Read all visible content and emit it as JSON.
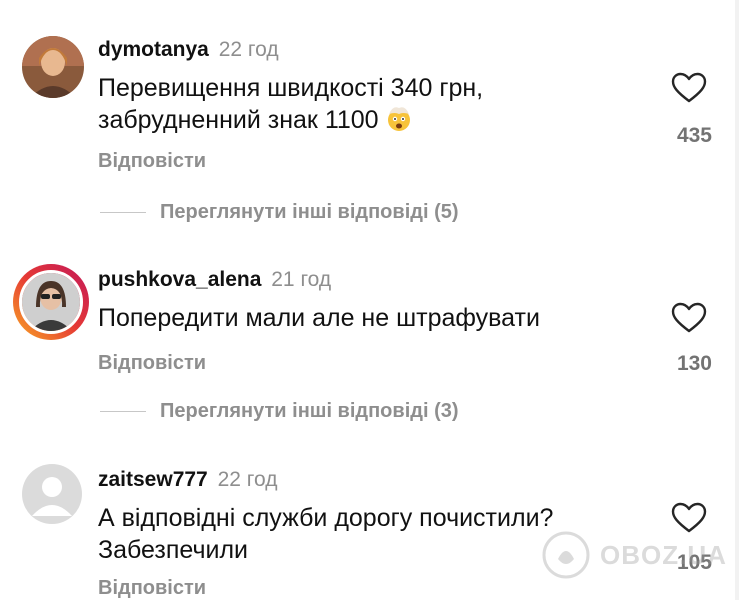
{
  "comments": [
    {
      "username": "dymotanya",
      "time": "22 год",
      "text_line1": "Перевищення швидкості 340 грн,",
      "text_line2": "забрудненний знак 1100",
      "emoji": "exploding-head-emoji",
      "reply_label": "Відповісти",
      "likes": "435",
      "view_replies": "Переглянути інші відповіді (5)"
    },
    {
      "username": "pushkova_alena",
      "time": "21 год",
      "text_line1": "Попередити мали але не штрафувати",
      "reply_label": "Відповісти",
      "likes": "130",
      "view_replies": "Переглянути інші відповіді (3)"
    },
    {
      "username": "zaitsew777",
      "time": "22 год",
      "text_line1": "А відповідні служби дорогу почистили?",
      "text_line2": "Забезпечили",
      "reply_label": "Відповісти",
      "likes": "105"
    }
  ],
  "watermark": {
    "text": "OBOZ.UA"
  },
  "colors": {
    "muted": "#8e8e8e",
    "story_ring_start": "#f9a825",
    "story_ring_end": "#c2185b"
  }
}
